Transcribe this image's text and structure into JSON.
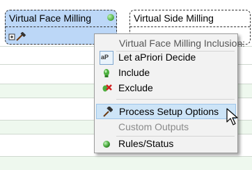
{
  "operations": [
    {
      "title": "Virtual Face Milling",
      "selected": true,
      "status_color": "#56b44a"
    },
    {
      "title": "Virtual Side Milling",
      "selected": false
    }
  ],
  "context_menu": {
    "header": "Virtual Face Milling Inclusion:",
    "items": [
      {
        "label": "Let aPriori Decide",
        "icon": "apriori-icon",
        "icon_text": "aP",
        "enabled": true
      },
      {
        "label": "Include",
        "icon": "green-bulb-icon",
        "enabled": true
      },
      {
        "label": "Exclude",
        "icon": "red-x-icon",
        "enabled": true
      },
      {
        "label": "Process Setup Options",
        "icon": "hammer-icon",
        "enabled": true,
        "hovered": true
      },
      {
        "label": "Custom Outputs",
        "icon": "",
        "enabled": false
      },
      {
        "label": "Rules/Status",
        "icon": "green-dot-icon",
        "enabled": true
      }
    ]
  },
  "colors": {
    "selected_card": "#bcd7f7",
    "menu_background": "#f2f2f2",
    "menu_hover": "#cde4f7",
    "disabled_text": "#8a8a8a"
  }
}
